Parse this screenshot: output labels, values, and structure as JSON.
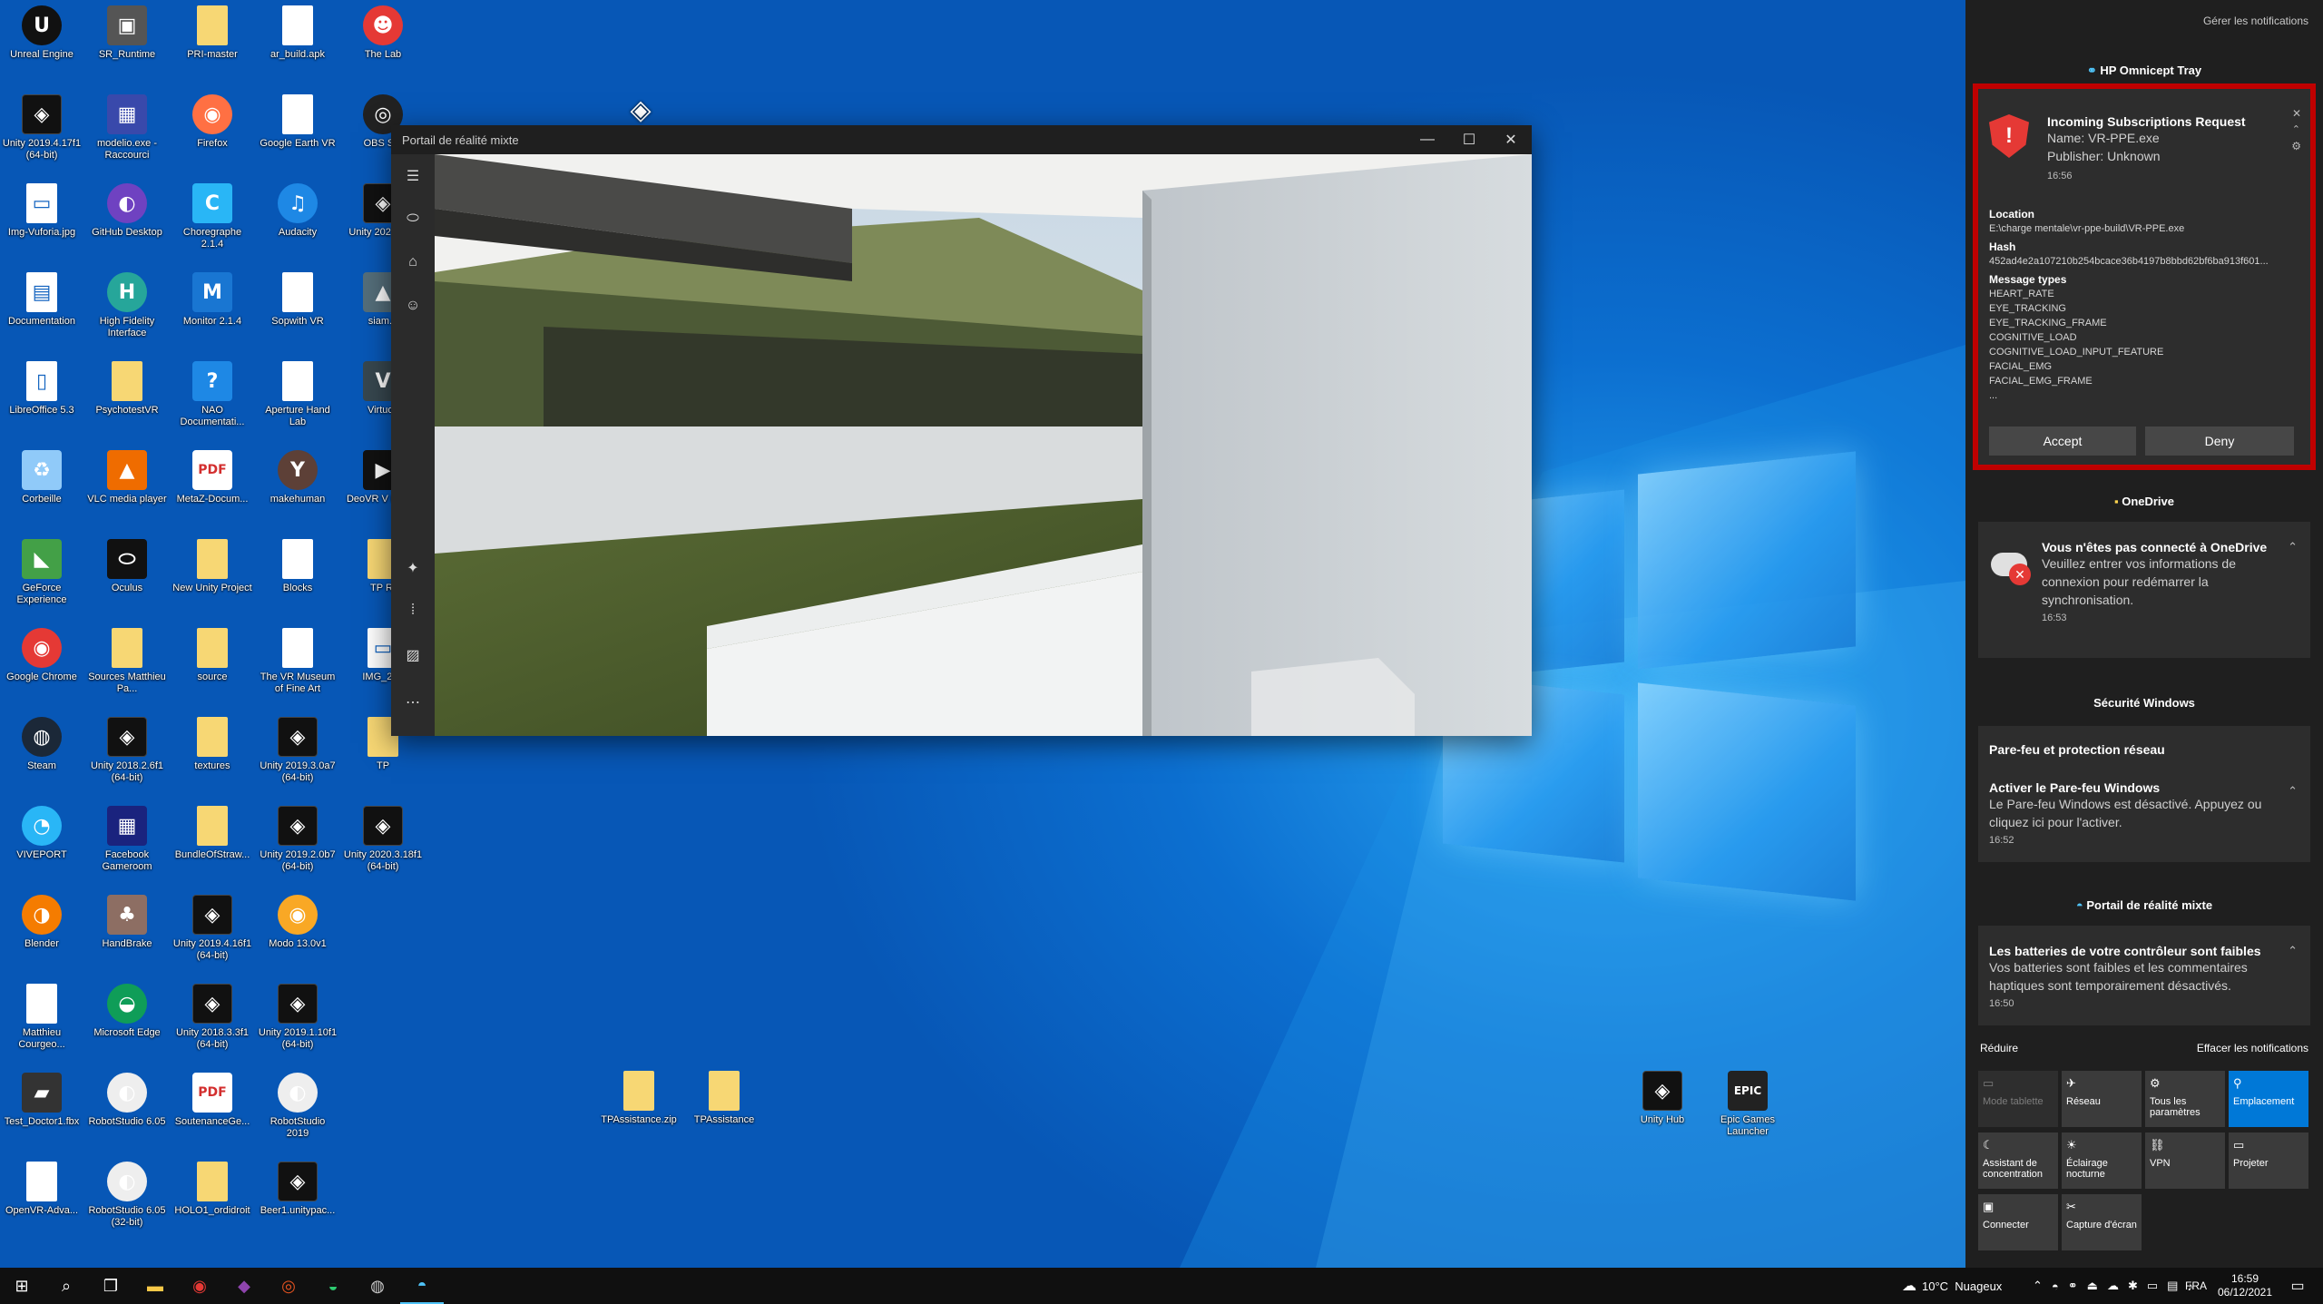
{
  "desktop_icons": [
    {
      "label": "Unreal Engine",
      "icon": "unreal-icon",
      "glyph": "U",
      "col": 0,
      "row": 0,
      "cls": "round",
      "bg": "#111"
    },
    {
      "label": "SR_Runtime",
      "icon": "sr-runtime-icon",
      "glyph": "▣",
      "col": 1,
      "row": 0,
      "cls": "",
      "bg": "#555"
    },
    {
      "label": "PRI-master",
      "icon": "folder-icon",
      "glyph": "",
      "col": 2,
      "row": 0,
      "cls": "folder",
      "bg": ""
    },
    {
      "label": "ar_build.apk",
      "icon": "file-icon",
      "glyph": "",
      "col": 3,
      "row": 0,
      "cls": "file",
      "bg": ""
    },
    {
      "label": "The Lab",
      "icon": "the-lab-icon",
      "glyph": "☻",
      "col": 4,
      "row": 0,
      "cls": "round",
      "bg": "#e53935"
    },
    {
      "label": "Unity 2019.4.17f1 (64-bit)",
      "icon": "unity-icon",
      "glyph": "◈",
      "col": 0,
      "row": 1,
      "cls": "unity",
      "bg": ""
    },
    {
      "label": "modelio.exe - Raccourci",
      "icon": "modelio-icon",
      "glyph": "▦",
      "col": 1,
      "row": 1,
      "cls": "",
      "bg": "#3949ab"
    },
    {
      "label": "Firefox",
      "icon": "firefox-icon",
      "glyph": "◉",
      "col": 2,
      "row": 1,
      "cls": "round",
      "bg": "#ff7043"
    },
    {
      "label": "Google Earth VR",
      "icon": "file-icon",
      "glyph": "",
      "col": 3,
      "row": 1,
      "cls": "file",
      "bg": ""
    },
    {
      "label": "OBS Stu",
      "icon": "obs-icon",
      "glyph": "◎",
      "col": 4,
      "row": 1,
      "cls": "round",
      "bg": "#222"
    },
    {
      "label": "Img-Vuforia.jpg",
      "icon": "image-file-icon",
      "glyph": "▭",
      "col": 0,
      "row": 2,
      "cls": "file",
      "bg": ""
    },
    {
      "label": "GitHub Desktop",
      "icon": "github-icon",
      "glyph": "◐",
      "col": 1,
      "row": 2,
      "cls": "round",
      "bg": "#6f42c1"
    },
    {
      "label": "Choregraphe 2.1.4",
      "icon": "choregraphe-icon",
      "glyph": "C",
      "col": 2,
      "row": 2,
      "cls": "",
      "bg": "#29b6f6"
    },
    {
      "label": "Audacity",
      "icon": "audacity-icon",
      "glyph": "♫",
      "col": 3,
      "row": 2,
      "cls": "round",
      "bg": "#1e88e5"
    },
    {
      "label": "Unity 202 (64-b",
      "icon": "unity-icon",
      "glyph": "◈",
      "col": 4,
      "row": 2,
      "cls": "unity",
      "bg": ""
    },
    {
      "label": "Documentation",
      "icon": "documentation-icon",
      "glyph": "▤",
      "col": 0,
      "row": 3,
      "cls": "file",
      "bg": ""
    },
    {
      "label": "High Fidelity Interface",
      "icon": "high-fidelity-icon",
      "glyph": "H",
      "col": 1,
      "row": 3,
      "cls": "round",
      "bg": "#26a69a"
    },
    {
      "label": "Monitor 2.1.4",
      "icon": "monitor-icon",
      "glyph": "M",
      "col": 2,
      "row": 3,
      "cls": "",
      "bg": "#1976d2"
    },
    {
      "label": "Sopwith VR",
      "icon": "file-icon",
      "glyph": "",
      "col": 3,
      "row": 3,
      "cls": "file",
      "bg": ""
    },
    {
      "label": "siam.p",
      "icon": "siam-icon",
      "glyph": "▲",
      "col": 4,
      "row": 3,
      "cls": "",
      "bg": "#546e7a"
    },
    {
      "label": "LibreOffice 5.3",
      "icon": "libreoffice-icon",
      "glyph": "▯",
      "col": 0,
      "row": 4,
      "cls": "file",
      "bg": ""
    },
    {
      "label": "PsychotestVR",
      "icon": "folder-icon",
      "glyph": "",
      "col": 1,
      "row": 4,
      "cls": "folder",
      "bg": ""
    },
    {
      "label": "NAO Documentati...",
      "icon": "help-icon",
      "glyph": "?",
      "col": 2,
      "row": 4,
      "cls": "",
      "bg": "#1e88e5"
    },
    {
      "label": "Aperture Hand Lab",
      "icon": "file-icon",
      "glyph": "",
      "col": 3,
      "row": 4,
      "cls": "file",
      "bg": ""
    },
    {
      "label": "Virtuos",
      "icon": "virtuos-icon",
      "glyph": "V",
      "col": 4,
      "row": 4,
      "cls": "",
      "bg": "#37474f"
    },
    {
      "label": "Corbeille",
      "icon": "recycle-bin-icon",
      "glyph": "♻",
      "col": 0,
      "row": 5,
      "cls": "",
      "bg": "#90caf9"
    },
    {
      "label": "VLC media player",
      "icon": "vlc-icon",
      "glyph": "▲",
      "col": 1,
      "row": 5,
      "cls": "",
      "bg": "#ef6c00"
    },
    {
      "label": "MetaZ-Docum...",
      "icon": "pdf-icon",
      "glyph": "PDF",
      "col": 2,
      "row": 5,
      "cls": "pdf",
      "bg": ""
    },
    {
      "label": "makehuman",
      "icon": "makehuman-icon",
      "glyph": "Y",
      "col": 3,
      "row": 5,
      "cls": "round",
      "bg": "#5d4037"
    },
    {
      "label": "DeoVR V Player",
      "icon": "deovr-icon",
      "glyph": "▶",
      "col": 4,
      "row": 5,
      "cls": "",
      "bg": "#111"
    },
    {
      "label": "GeForce Experience",
      "icon": "geforce-icon",
      "glyph": "◣",
      "col": 0,
      "row": 6,
      "cls": "",
      "bg": "#43a047"
    },
    {
      "label": "Oculus",
      "icon": "oculus-icon",
      "glyph": "⬭",
      "col": 1,
      "row": 6,
      "cls": "",
      "bg": "#111"
    },
    {
      "label": "New Unity Project",
      "icon": "folder-icon",
      "glyph": "",
      "col": 2,
      "row": 6,
      "cls": "folder",
      "bg": ""
    },
    {
      "label": "Blocks",
      "icon": "file-icon",
      "glyph": "",
      "col": 3,
      "row": 6,
      "cls": "file",
      "bg": ""
    },
    {
      "label": "TP RI",
      "icon": "folder-icon",
      "glyph": "",
      "col": 4,
      "row": 6,
      "cls": "folder",
      "bg": ""
    },
    {
      "label": "Google Chrome",
      "icon": "chrome-icon",
      "glyph": "◉",
      "col": 0,
      "row": 7,
      "cls": "round",
      "bg": "#e53935"
    },
    {
      "label": "Sources Matthieu Pa...",
      "icon": "folder-icon",
      "glyph": "",
      "col": 1,
      "row": 7,
      "cls": "folder",
      "bg": ""
    },
    {
      "label": "source",
      "icon": "folder-icon",
      "glyph": "",
      "col": 2,
      "row": 7,
      "cls": "folder",
      "bg": ""
    },
    {
      "label": "The VR Museum of Fine Art",
      "icon": "file-icon",
      "glyph": "",
      "col": 3,
      "row": 7,
      "cls": "file",
      "bg": ""
    },
    {
      "label": "IMG_202",
      "icon": "image-file-icon",
      "glyph": "▭",
      "col": 4,
      "row": 7,
      "cls": "file",
      "bg": ""
    },
    {
      "label": "Steam",
      "icon": "steam-icon",
      "glyph": "◍",
      "col": 0,
      "row": 8,
      "cls": "round",
      "bg": "#1b2838"
    },
    {
      "label": "Unity 2018.2.6f1 (64-bit)",
      "icon": "unity-icon",
      "glyph": "◈",
      "col": 1,
      "row": 8,
      "cls": "unity",
      "bg": ""
    },
    {
      "label": "textures",
      "icon": "folder-icon",
      "glyph": "",
      "col": 2,
      "row": 8,
      "cls": "folder",
      "bg": ""
    },
    {
      "label": "Unity 2019.3.0a7 (64-bit)",
      "icon": "unity-icon",
      "glyph": "◈",
      "col": 3,
      "row": 8,
      "cls": "unity",
      "bg": ""
    },
    {
      "label": "TP",
      "icon": "folder-icon",
      "glyph": "",
      "col": 4,
      "row": 8,
      "cls": "folder",
      "bg": ""
    },
    {
      "label": "VIVEPORT",
      "icon": "viveport-icon",
      "glyph": "◔",
      "col": 0,
      "row": 9,
      "cls": "round",
      "bg": "#29b6f6"
    },
    {
      "label": "Facebook Gameroom",
      "icon": "gameroom-icon",
      "glyph": "▦",
      "col": 1,
      "row": 9,
      "cls": "",
      "bg": "#1a237e"
    },
    {
      "label": "BundleOfStraw...",
      "icon": "folder-icon",
      "glyph": "",
      "col": 2,
      "row": 9,
      "cls": "folder",
      "bg": ""
    },
    {
      "label": "Unity 2019.2.0b7 (64-bit)",
      "icon": "unity-icon",
      "glyph": "◈",
      "col": 3,
      "row": 9,
      "cls": "unity",
      "bg": ""
    },
    {
      "label": "Unity 2020.3.18f1 (64-bit)",
      "icon": "unity-icon",
      "glyph": "◈",
      "col": 4,
      "row": 9,
      "cls": "unity",
      "bg": ""
    },
    {
      "label": "Blender",
      "icon": "blender-icon",
      "glyph": "◑",
      "col": 0,
      "row": 10,
      "cls": "round",
      "bg": "#f57c00"
    },
    {
      "label": "HandBrake",
      "icon": "handbrake-icon",
      "glyph": "♣",
      "col": 1,
      "row": 10,
      "cls": "",
      "bg": "#8d6e63"
    },
    {
      "label": "Unity 2019.4.16f1 (64-bit)",
      "icon": "unity-icon",
      "glyph": "◈",
      "col": 2,
      "row": 10,
      "cls": "unity",
      "bg": ""
    },
    {
      "label": "Modo 13.0v1",
      "icon": "modo-icon",
      "glyph": "◉",
      "col": 3,
      "row": 10,
      "cls": "round",
      "bg": "#f9a825"
    },
    {
      "label": "Matthieu Courgeo...",
      "icon": "file-icon",
      "glyph": "",
      "col": 0,
      "row": 11,
      "cls": "file",
      "bg": ""
    },
    {
      "label": "Microsoft Edge",
      "icon": "edge-icon",
      "glyph": "◒",
      "col": 1,
      "row": 11,
      "cls": "round",
      "bg": "#0f9d58"
    },
    {
      "label": "Unity 2018.3.3f1 (64-bit)",
      "icon": "unity-icon",
      "glyph": "◈",
      "col": 2,
      "row": 11,
      "cls": "unity",
      "bg": ""
    },
    {
      "label": "Unity 2019.1.10f1 (64-bit)",
      "icon": "unity-icon",
      "glyph": "◈",
      "col": 3,
      "row": 11,
      "cls": "unity",
      "bg": ""
    },
    {
      "label": "Test_Doctor1.fbx",
      "icon": "fbx-icon",
      "glyph": "▰",
      "col": 0,
      "row": 12,
      "cls": "",
      "bg": "#333"
    },
    {
      "label": "RobotStudio 6.05",
      "icon": "robotstudio-icon",
      "glyph": "◐",
      "col": 1,
      "row": 12,
      "cls": "round",
      "bg": "#eeeeee"
    },
    {
      "label": "SoutenanceGe...",
      "icon": "pdf-icon",
      "glyph": "PDF",
      "col": 2,
      "row": 12,
      "cls": "pdf",
      "bg": ""
    },
    {
      "label": "RobotStudio 2019",
      "icon": "robotstudio-icon",
      "glyph": "◐",
      "col": 3,
      "row": 12,
      "cls": "round",
      "bg": "#eeeeee"
    },
    {
      "label": "OpenVR-Adva...",
      "icon": "file-icon",
      "glyph": "",
      "col": 0,
      "row": 13,
      "cls": "file",
      "bg": ""
    },
    {
      "label": "RobotStudio 6.05 (32-bit)",
      "icon": "robotstudio-icon",
      "glyph": "◐",
      "col": 1,
      "row": 13,
      "cls": "round",
      "bg": "#eeeeee"
    },
    {
      "label": "HOLO1_ordidroit",
      "icon": "folder-icon",
      "glyph": "",
      "col": 2,
      "row": 13,
      "cls": "folder",
      "bg": ""
    },
    {
      "label": "Beer1.unitypac...",
      "icon": "unitypackage-icon",
      "glyph": "◈",
      "col": 3,
      "row": 13,
      "cls": "unity",
      "bg": ""
    }
  ],
  "free_icons": [
    {
      "label": "TPAssistance.zip",
      "icon": "zip-folder-icon",
      "glyph": "",
      "cls": "folder",
      "bg": "",
      "pos": "a"
    },
    {
      "label": "TPAssistance",
      "icon": "folder-icon",
      "glyph": "",
      "cls": "folder",
      "bg": "",
      "pos": "b"
    },
    {
      "label": "Unity Hub",
      "icon": "unity-hub-icon",
      "glyph": "◈",
      "cls": "unity",
      "bg": "",
      "pos": "c"
    },
    {
      "label": "Epic Games Launcher",
      "icon": "epic-games-icon",
      "glyph": "EPIC",
      "cls": "",
      "bg": "#222",
      "pos": "d"
    }
  ],
  "mr_window": {
    "title": "Portail de réalité mixte",
    "minimize": "—",
    "maximize": "☐",
    "close": "✕",
    "menu": "☰",
    "more": "⋯"
  },
  "action_center": {
    "manage_label": "Gérer les notifications",
    "hp": {
      "group": "HP Omnicept Tray",
      "title": "Incoming Subscriptions Request",
      "name": "Name: VR-PPE.exe",
      "publisher": "Publisher: Unknown",
      "time": "16:56",
      "location_label": "Location",
      "location": "E:\\charge mentale\\vr-ppe-build\\VR-PPE.exe",
      "hash_label": "Hash",
      "hash": "452ad4e2a107210b254bcace36b4197b8bbd62bf6ba913f601...",
      "types_label": "Message types",
      "types": [
        "HEART_RATE",
        "EYE_TRACKING",
        "EYE_TRACKING_FRAME",
        "COGNITIVE_LOAD",
        "COGNITIVE_LOAD_INPUT_FEATURE",
        "FACIAL_EMG",
        "FACIAL_EMG_FRAME",
        "..."
      ],
      "accept": "Accept",
      "deny": "Deny",
      "highlight": "#c00000"
    },
    "onedrive": {
      "group": "OneDrive",
      "title": "Vous n'êtes pas connecté à OneDrive",
      "body": "Veuillez entrer vos informations de connexion pour redémarrer la synchronisation.",
      "time": "16:53"
    },
    "security": {
      "group": "Sécurité Windows",
      "subtitle": "Pare-feu et protection réseau",
      "title": "Activer le Pare-feu Windows",
      "body": "Le Pare-feu Windows est désactivé. Appuyez ou cliquez ici pour l'activer.",
      "time": "16:52"
    },
    "mixed": {
      "group": "Portail de réalité mixte",
      "title": "Les batteries de votre contrôleur sont faibles",
      "body": "Vos batteries sont faibles et les commentaires haptiques sont temporairement désactivés.",
      "time": "16:50"
    },
    "reduce": "Réduire",
    "clear": "Effacer les notifications",
    "tiles": [
      {
        "label": "Mode tablette",
        "icon": "tablet-mode-icon",
        "glyph": "▭",
        "state": "dis"
      },
      {
        "label": "Réseau",
        "icon": "network-icon",
        "glyph": "✈",
        "state": ""
      },
      {
        "label": "Tous les paramètres",
        "icon": "settings-icon",
        "glyph": "⚙",
        "state": ""
      },
      {
        "label": "Emplacement",
        "icon": "location-icon",
        "glyph": "⚲",
        "state": "on"
      },
      {
        "label": "Assistant de concentration",
        "icon": "moon-icon",
        "glyph": "☾",
        "state": ""
      },
      {
        "label": "Éclairage nocturne",
        "icon": "night-light-icon",
        "glyph": "☀",
        "state": ""
      },
      {
        "label": "VPN",
        "icon": "vpn-icon",
        "glyph": "⛓",
        "state": ""
      },
      {
        "label": "Projeter",
        "icon": "project-icon",
        "glyph": "▭",
        "state": ""
      },
      {
        "label": "Connecter",
        "icon": "connect-icon",
        "glyph": "▣",
        "state": ""
      },
      {
        "label": "Capture d'écran",
        "icon": "screen-snip-icon",
        "glyph": "✂",
        "state": ""
      }
    ]
  },
  "taskbar": {
    "apps": [
      {
        "icon": "start-icon",
        "glyph": "⊞",
        "color": "#ffffff"
      },
      {
        "icon": "search-icon",
        "glyph": "⌕",
        "color": "#ffffff"
      },
      {
        "icon": "task-view-icon",
        "glyph": "❐",
        "color": "#ffffff"
      },
      {
        "icon": "file-explorer-icon",
        "glyph": "▬",
        "color": "#f7c948"
      },
      {
        "icon": "chrome-icon",
        "glyph": "◉",
        "color": "#e53935"
      },
      {
        "icon": "visual-studio-icon",
        "glyph": "◆",
        "color": "#8e44ad"
      },
      {
        "icon": "ubuntu-icon",
        "glyph": "◎",
        "color": "#e95420"
      },
      {
        "icon": "edge-icon",
        "glyph": "◒",
        "color": "#2ecc71"
      },
      {
        "icon": "steam-vr-icon",
        "glyph": "◍",
        "color": "#cccccc"
      },
      {
        "icon": "mixed-reality-icon",
        "glyph": "◓",
        "color": "#4fc3f7"
      }
    ],
    "weather": "10°C  Nuageux",
    "lang": "FRA",
    "time": "16:59",
    "date": "06/12/2021"
  }
}
